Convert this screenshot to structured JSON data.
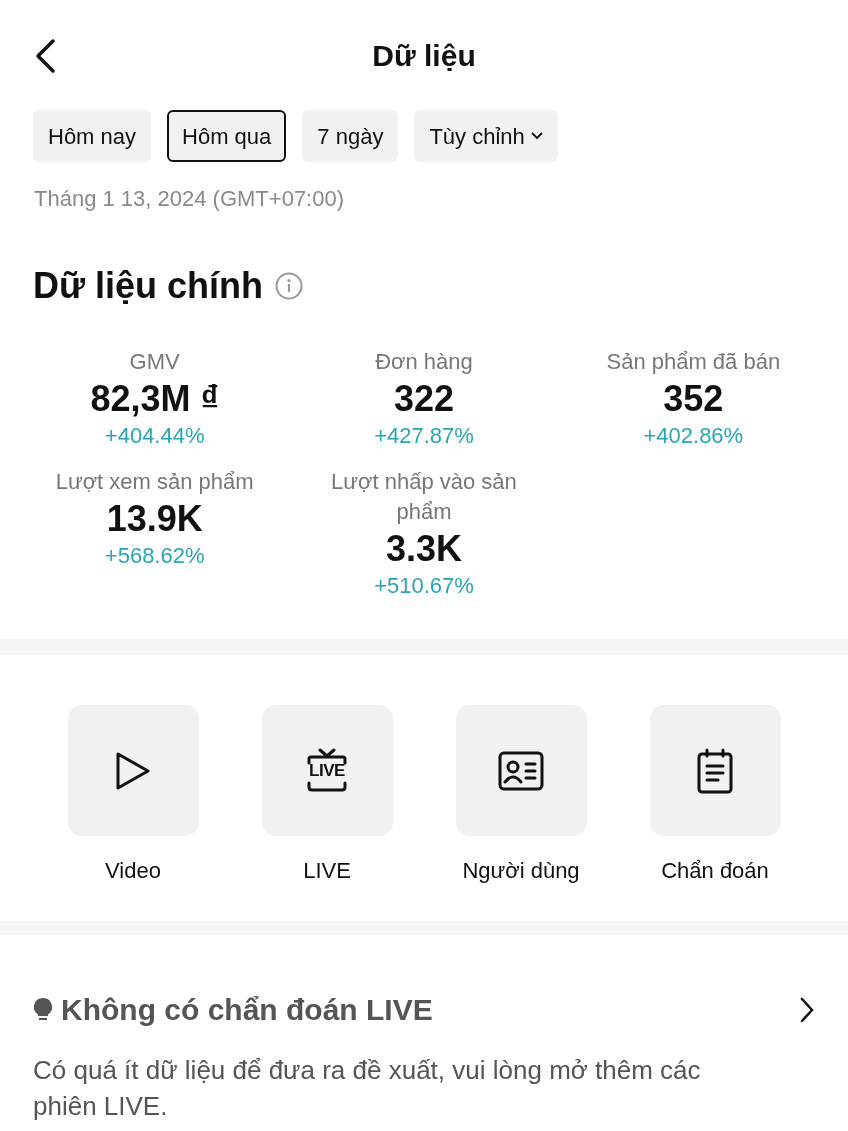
{
  "header": {
    "title": "Dữ liệu"
  },
  "filters": [
    {
      "label": "Hôm nay",
      "selected": false,
      "dropdown": false
    },
    {
      "label": "Hôm qua",
      "selected": true,
      "dropdown": false
    },
    {
      "label": "7 ngày",
      "selected": false,
      "dropdown": false
    },
    {
      "label": "Tùy chỉnh",
      "selected": false,
      "dropdown": true
    }
  ],
  "date": "Tháng 1 13, 2024 (GMT+07:00)",
  "main_data": {
    "title": "Dữ liệu chính",
    "metrics": [
      {
        "label": "GMV",
        "value": "82,3M ₫",
        "change": "+404.44%"
      },
      {
        "label": "Đơn hàng",
        "value": "322",
        "change": "+427.87%"
      },
      {
        "label": "Sản phẩm đã bán",
        "value": "352",
        "change": "+402.86%"
      },
      {
        "label": "Lượt xem sản phẩm",
        "value": "13.9K",
        "change": "+568.62%"
      },
      {
        "label": "Lượt nhấp vào sản phẩm",
        "value": "3.3K",
        "change": "+510.67%"
      }
    ]
  },
  "shortcuts": [
    {
      "kind": "video",
      "label": "Video"
    },
    {
      "kind": "live",
      "label": "LIVE",
      "icon_text": "LIVE"
    },
    {
      "kind": "user",
      "label": "Người dùng"
    },
    {
      "kind": "diagnosis",
      "label": "Chẩn đoán"
    }
  ],
  "insight": {
    "title": "Không có chẩn đoán LIVE",
    "text": "Có quá ít dữ liệu để đưa ra đề xuất, vui lòng mở thêm các phiên LIVE."
  }
}
